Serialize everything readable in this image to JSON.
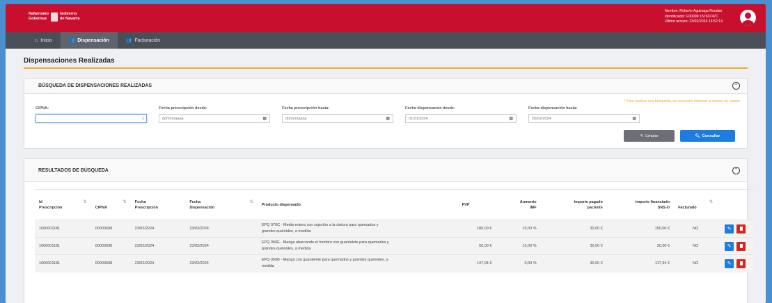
{
  "header": {
    "logo_line1_left": "Nafarroako",
    "logo_line2_left": "Gobernua",
    "logo_line1_right": "Gobierno",
    "logo_line2_right": "de Navarra",
    "user_name": "Nombre: Roberto Aguinaga Roudan",
    "user_id": "Identificador: F00099 15763747C",
    "last_access": "Último acceso: 23/02/2024 13:52:14"
  },
  "nav": {
    "inicio": "Inicio",
    "dispensacion": "Dispensación",
    "facturacion": "Facturación"
  },
  "page_title": "Dispensaciones Realizadas",
  "search": {
    "title": "BÚSQUEDA DE DISPENSACIONES REALIZADAS",
    "notice": "* Para realizar una búsqueda, es necesario informar al menos un campo",
    "cipna_label": "CIPNA:",
    "cipna_value": "",
    "presc_desde_label": "Fecha prescripción desde:",
    "presc_desde_value": "dd/mm/aaaa",
    "presc_hasta_label": "Fecha prescripción hasta:",
    "presc_hasta_value": "dd/mm/aaaa",
    "disp_desde_label": "Fecha dispensación desde:",
    "disp_desde_value": "01/01/2024",
    "disp_hasta_label": "Fecha dispensación hasta:",
    "disp_hasta_value": "26/02/2024",
    "clear_label": "Limpiar",
    "search_label": "Consultar"
  },
  "results": {
    "title": "RESULTADOS DE BÚSQUEDA",
    "columns": {
      "id_1": "Id",
      "id_2": "Prescripción",
      "cipna": "CIPNA",
      "fpres_1": "Fecha",
      "fpres_2": "Prescripción",
      "fdisp_1": "Fecha",
      "fdisp_2": "Dispensación",
      "producto": "Producto dispensado",
      "pvp": "PVP",
      "aumento_1": "Aumento",
      "aumento_2": "IMF",
      "pagado_1": "Importe pagado",
      "pagado_2": "paciente",
      "financiado_1": "Importe financiado",
      "financiado_2": "SNS-O",
      "facturado": "Facturado"
    },
    "rows": [
      {
        "id": "1000001181",
        "cipna": "00000698",
        "fecha_prescripcion": "23/02/2024",
        "fecha_dispensacion": "23/02/2024",
        "producto_1": "EPQ 070C - Media entera con sujeción a la cintura para quemados y",
        "producto_2": "grandes queloides, a medida",
        "pvp": "180,00 €",
        "aumento": "15,00 %",
        "pagado": "30,00 €",
        "financiado": "150,00 €",
        "facturado": "NO"
      },
      {
        "id": "1000001181",
        "cipna": "00000698",
        "fecha_prescripcion": "23/02/2024",
        "fecha_dispensacion": "23/02/2024",
        "producto_1": "EPQ 050E - Manga abarcando el hombro con guantelete para quemados y",
        "producto_2": "grandes queloides, a medida",
        "pvp": "50,00 €",
        "aumento": "15,00 %",
        "pagado": "30,00 €",
        "financiado": "20,00 €",
        "facturado": "NO"
      },
      {
        "id": "1000001181",
        "cipna": "00000698",
        "fecha_prescripcion": "23/02/2024",
        "fecha_dispensacion": "23/02/2024",
        "producto_1": "EPQ 050B - Manga con guantelete para quemados y grandes queloides, a",
        "producto_2": "medida",
        "pvp": "147,94 €",
        "aumento": "0,00 %",
        "pagado": "30,00 €",
        "financiado": "117,94 €",
        "facturado": "NO"
      }
    ]
  },
  "colors": {
    "brand_red": "#c8102e",
    "nav_dark": "#4a4e57",
    "accent_orange": "#f0a830",
    "primary_blue": "#1c7ce0",
    "delete_red": "#d9261c"
  }
}
